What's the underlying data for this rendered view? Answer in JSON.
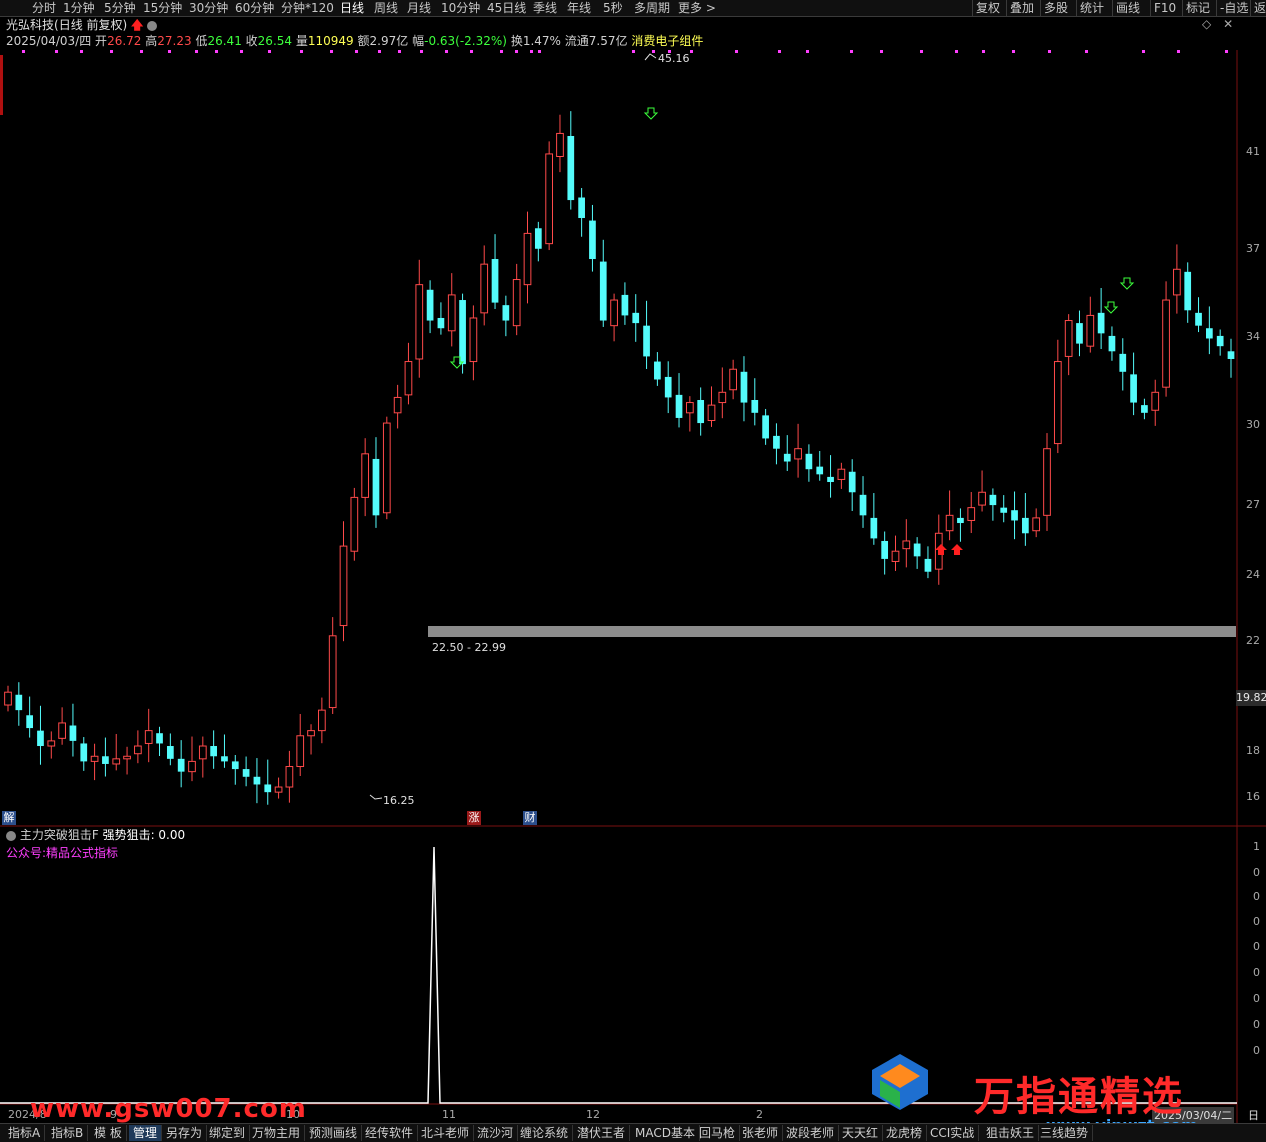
{
  "toolbar": {
    "periods": [
      "分时",
      "1分钟",
      "5分钟",
      "15分钟",
      "30分钟",
      "60分钟",
      "分钟*120",
      "日线",
      "周线",
      "月线",
      "10分钟",
      "45日线",
      "季线",
      "年线",
      "5秒",
      "多周期",
      "更多 >"
    ],
    "active_period": "日线",
    "right_buttons": [
      "复权",
      "叠加",
      "多股",
      "统计",
      "画线",
      "F10",
      "标记",
      "-自选",
      "返"
    ]
  },
  "stock": {
    "name": "光弘科技",
    "mode": "(日线 前复权)",
    "date": "2025/04/03/四",
    "open_label": "开",
    "open": "26.72",
    "high_label": "高",
    "high": "27.23",
    "low_label": "低",
    "low": "26.41",
    "close_label": "收",
    "close": "26.54",
    "volume_label": "量",
    "volume": "110949",
    "amount_label": "额",
    "amount": "2.97亿",
    "change_label": "幅",
    "change": "-0.63(-2.32%)",
    "turnover_label": "换",
    "turnover": "1.47%",
    "float_label": "流通",
    "float_cap": "7.57亿",
    "sector": "消费电子组件"
  },
  "price_axis": {
    "ticks": [
      "41",
      "37",
      "34",
      "30",
      "27",
      "24",
      "22",
      "18",
      "16"
    ],
    "current_price": "19.82"
  },
  "annotations": {
    "high_label": "45.16",
    "low_label": "16.25",
    "zone_label": "22.50 - 22.99"
  },
  "markers": [
    "解",
    "涨",
    "财"
  ],
  "indicator": {
    "name": "主力突破狙击F",
    "value_label": "强势狙击: 0.00",
    "subtitle": "公众号:精品公式指标",
    "axis_ticks": [
      "1",
      "0",
      "0",
      "0",
      "0",
      "0",
      "0",
      "0",
      "0"
    ]
  },
  "x_axis": {
    "labels": [
      "2024/8",
      "9",
      "10",
      "11",
      "12",
      "2",
      "2025/03/04/二"
    ],
    "right_tab": "日线"
  },
  "bottom_tabs": [
    "指标A",
    "指标B",
    "模 板",
    "管理",
    "另存为",
    "绑定到",
    "万物主用",
    "预测画线",
    "经传软件",
    "北斗老师",
    "流沙河",
    "缠论系统",
    "潜伏王者",
    "MACD基本",
    "回马枪",
    "张老师",
    "波段老师",
    "天天红",
    "龙虎榜",
    "CCI实战",
    "狙击妖王",
    "三线趋势"
  ],
  "active_bottom_tab": "管理",
  "watermarks": {
    "left": "www.gsw007.com",
    "right": "万指通精选",
    "right_sub": "www.vipwzt.com"
  },
  "colors": {
    "up": "#ff4a4a",
    "down": "#54fcfc",
    "support_band": "#8c8c8c",
    "indicator_line": "#ffffff"
  }
}
